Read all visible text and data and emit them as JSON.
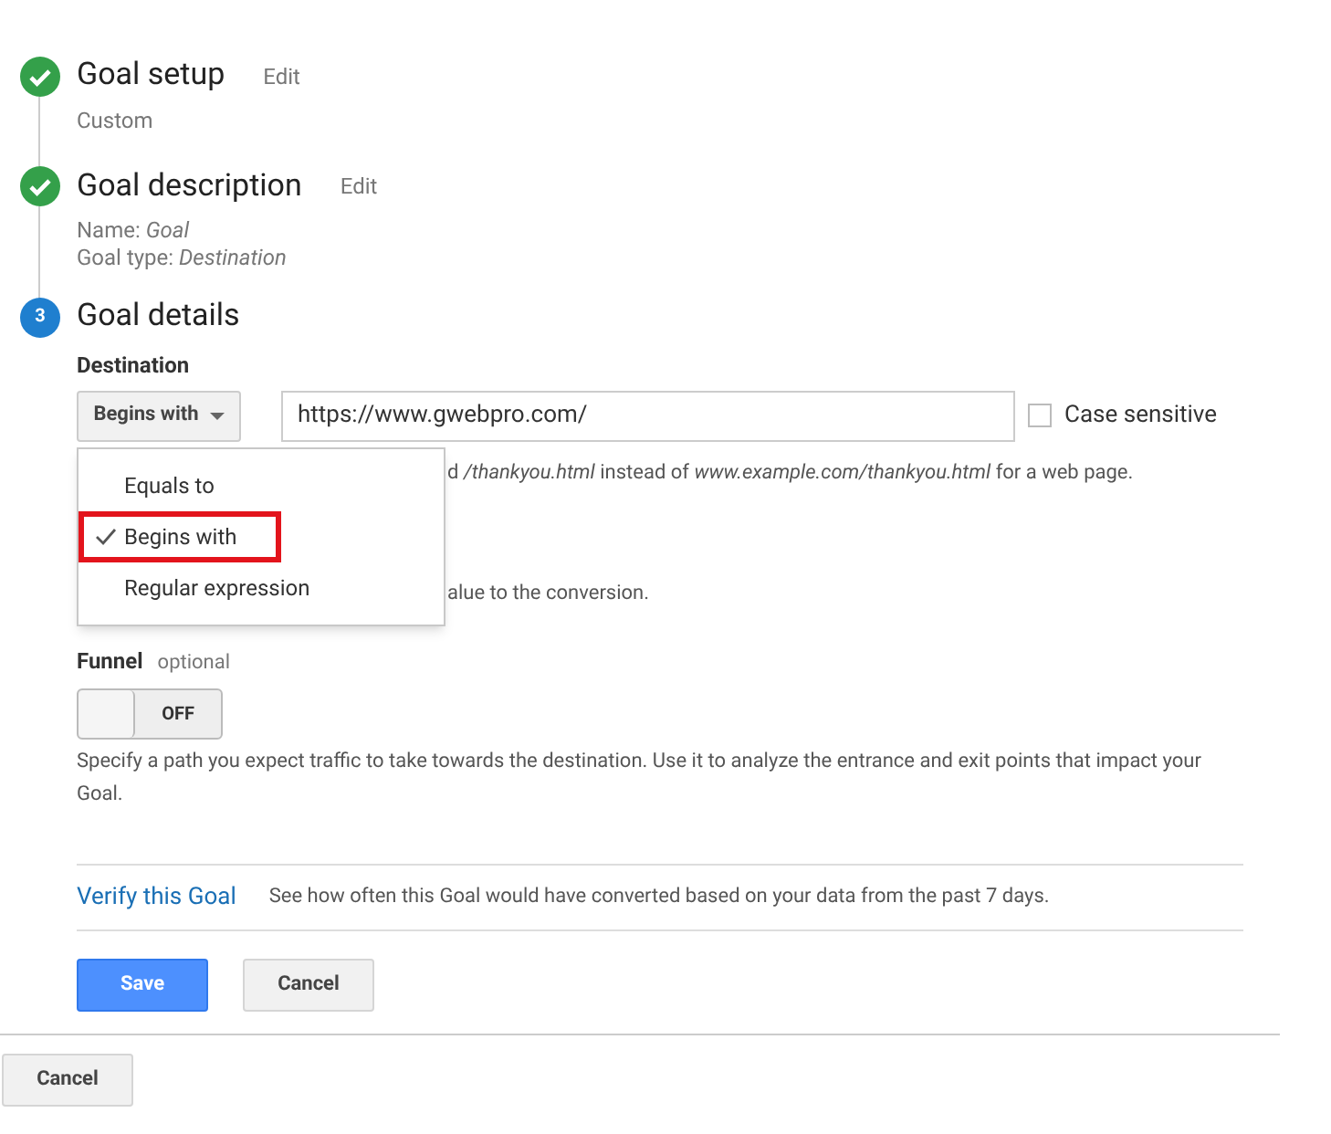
{
  "steps": [
    {
      "kind": "done",
      "title": "Goal setup",
      "edit": "Edit",
      "lines": [
        "Custom"
      ]
    },
    {
      "kind": "done",
      "title": "Goal description",
      "edit": "Edit",
      "lines": [
        "Name: *Goal*",
        "Goal type: *Destination*"
      ]
    },
    {
      "kind": "number",
      "number": "3",
      "title": "Goal details"
    }
  ],
  "destination": {
    "label": "Destination",
    "match_button": "Begins with",
    "url": "https://www.gwebpro.com/",
    "case_sensitive": {
      "label": "Case sensitive",
      "checked": false
    },
    "hint": "d */thankyou.html* instead of *www.example.com/thankyou.html* for a web page."
  },
  "match_menu": [
    {
      "label": "Equals to",
      "selected": false
    },
    {
      "label": "Begins with",
      "selected": true
    },
    {
      "label": "Regular expression",
      "selected": false
    }
  ],
  "value_hint": "alue to the conversion.",
  "funnel": {
    "label": "Funnel",
    "optional": "optional",
    "toggle": {
      "label": "OFF",
      "on": false
    },
    "hint": "Specify a path you expect traffic to take towards the destination. Use it to analyze the entrance and exit points that impact your Goal."
  },
  "verify": {
    "link": "Verify this Goal",
    "text": "See how often this Goal would have converted based on your data from the past 7 days."
  },
  "buttons": {
    "save": "Save",
    "cancel": "Cancel"
  },
  "footer_cancel": "Cancel"
}
